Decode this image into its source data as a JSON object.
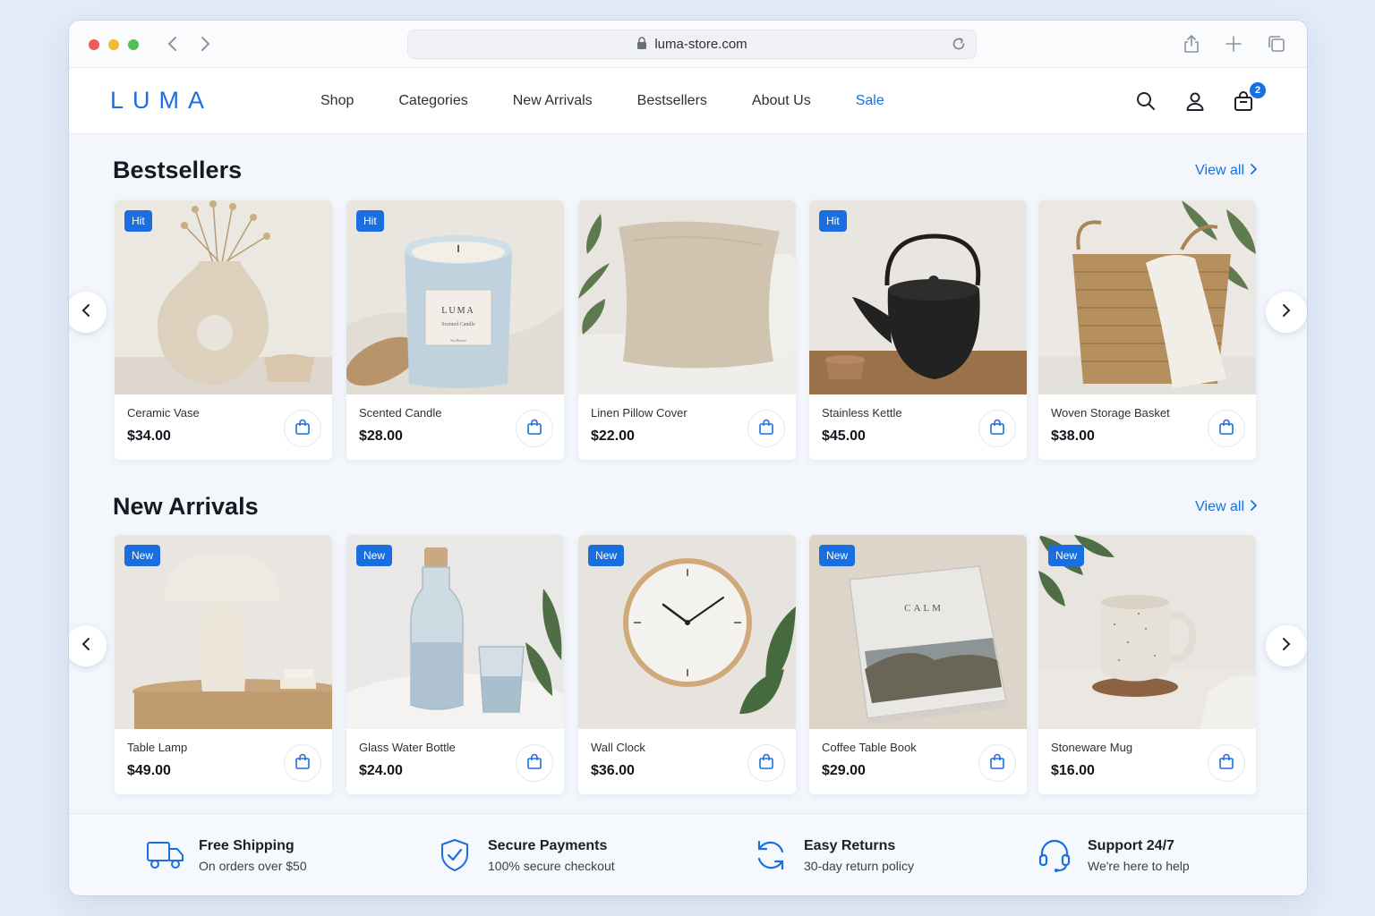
{
  "browser": {
    "url": "luma-store.com"
  },
  "header": {
    "logo": "LUMA",
    "nav": [
      "Shop",
      "Categories",
      "New Arrivals",
      "Bestsellers",
      "About Us",
      "Sale"
    ],
    "cart_count": "2",
    "icons": [
      "search-icon",
      "user-icon",
      "bag-icon"
    ]
  },
  "bestsellers": {
    "title": "Bestsellers",
    "view_all": "View all",
    "products": [
      {
        "name": "Ceramic Vase",
        "price": "$34.00",
        "badge": "Hit"
      },
      {
        "name": "Scented Candle",
        "price": "$28.00",
        "badge": "Hit",
        "label_text": "LUMA",
        "label_sub": "Scented Candle",
        "label_note": "Sea Breeze"
      },
      {
        "name": "Linen Pillow Cover",
        "price": "$22.00",
        "badge": ""
      },
      {
        "name": "Stainless Kettle",
        "price": "$45.00",
        "badge": "Hit"
      },
      {
        "name": "Woven Storage Basket",
        "price": "$38.00",
        "badge": ""
      }
    ]
  },
  "new_arrivals": {
    "title": "New Arrivals",
    "view_all": "View all",
    "products": [
      {
        "name": "Table Lamp",
        "price": "$49.00",
        "badge": "New"
      },
      {
        "name": "Glass Water Bottle",
        "price": "$24.00",
        "badge": "New"
      },
      {
        "name": "Wall Clock",
        "price": "$36.00",
        "badge": "New"
      },
      {
        "name": "Coffee Table Book",
        "price": "$29.00",
        "badge": "New",
        "cover_text": "CALM"
      },
      {
        "name": "Stoneware Mug",
        "price": "$16.00",
        "badge": "New"
      }
    ]
  },
  "features": [
    {
      "title": "Free Shipping",
      "subtitle": "On orders over $50",
      "icon": "truck-icon"
    },
    {
      "title": "Secure Payments",
      "subtitle": "100% secure checkout",
      "icon": "shield-check-icon"
    },
    {
      "title": "Easy Returns",
      "subtitle": "30-day return policy",
      "icon": "refresh-icon"
    },
    {
      "title": "Support 24/7",
      "subtitle": "We're here to help",
      "icon": "headset-icon"
    }
  ],
  "colors": {
    "accent": "#1a6fe0",
    "background": "#e3ecf8"
  }
}
